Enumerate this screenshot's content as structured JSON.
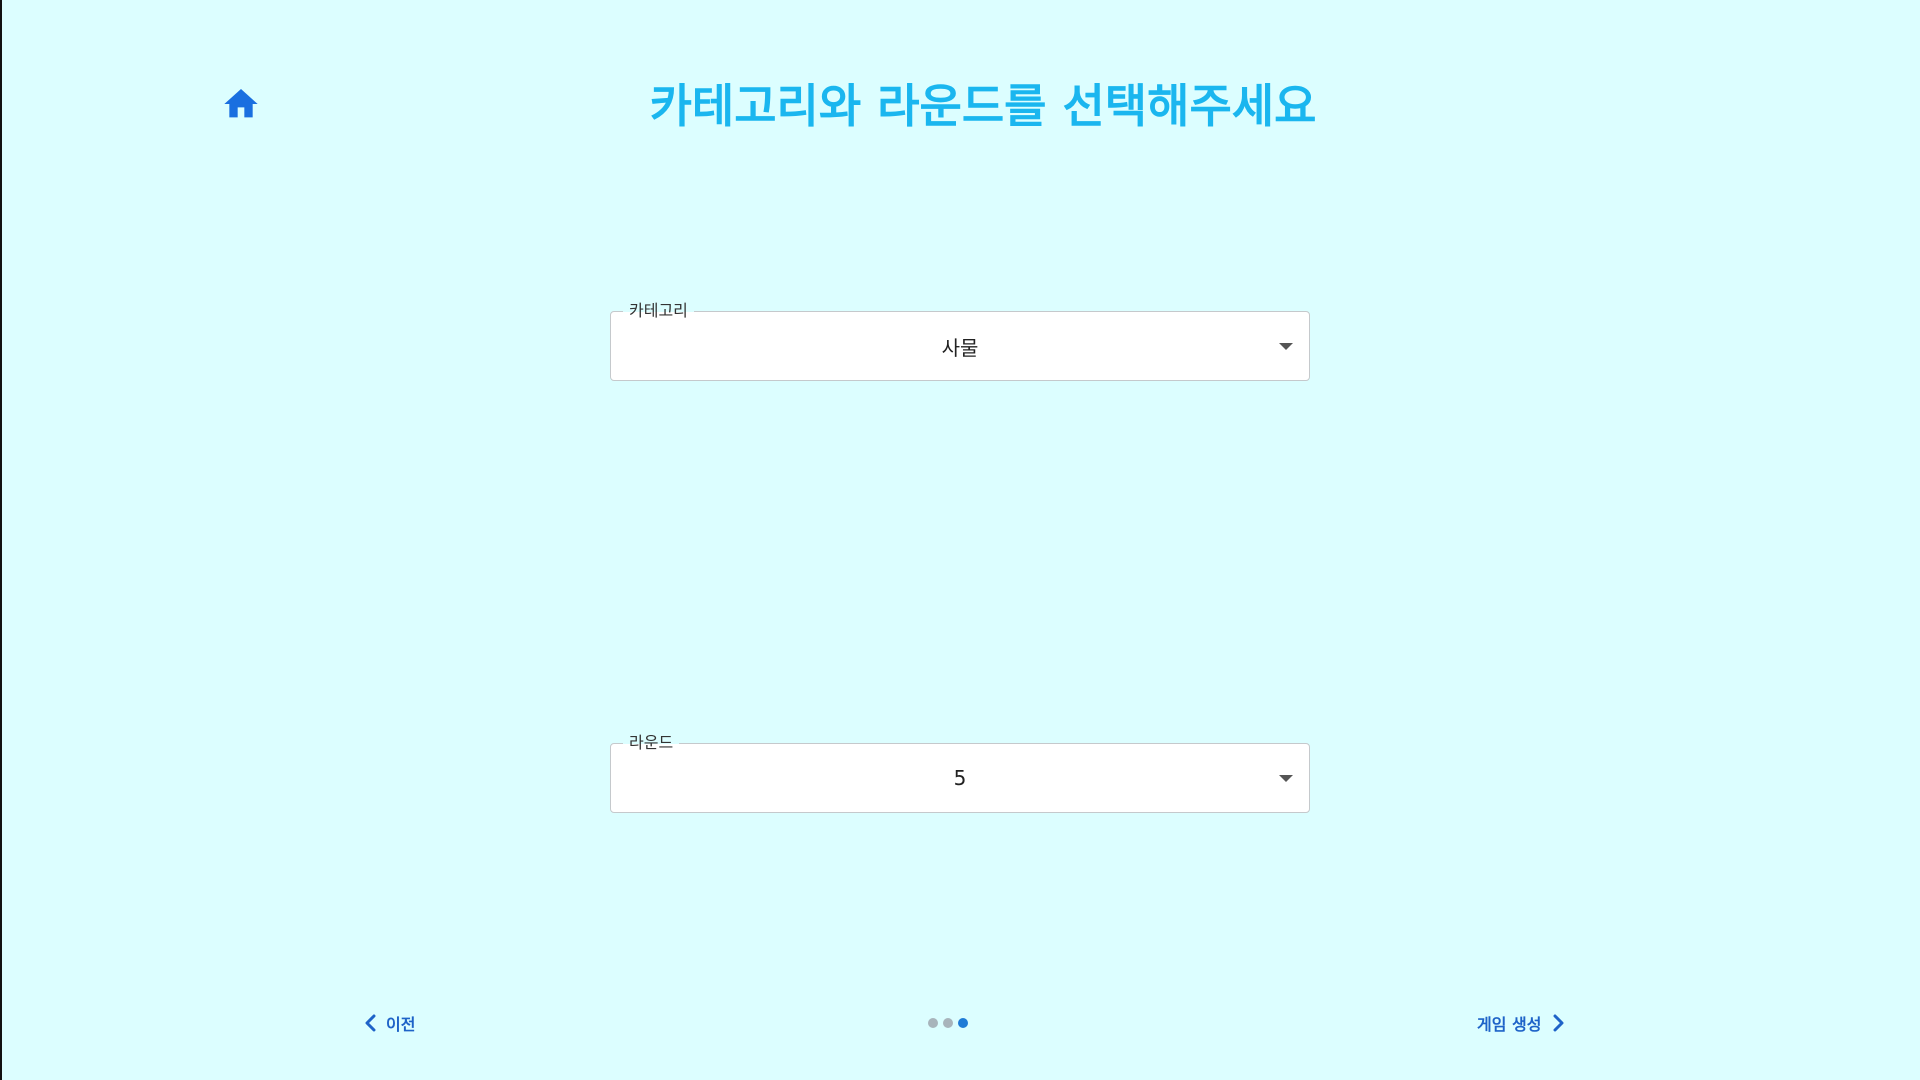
{
  "header": {
    "title": "카테고리와 라운드를 선택해주세요",
    "home_icon": "home-icon"
  },
  "form": {
    "category": {
      "label": "카테고리",
      "value": "사물"
    },
    "round": {
      "label": "라운드",
      "value": "5"
    }
  },
  "footer": {
    "prev_label": "이전",
    "next_label": "게임 생성",
    "pagination": {
      "total": 3,
      "current": 3
    }
  },
  "colors": {
    "background": "#dcfeff",
    "title": "#1ab6ef",
    "accent": "#1e63c8",
    "home_icon": "#1a6fe0"
  }
}
